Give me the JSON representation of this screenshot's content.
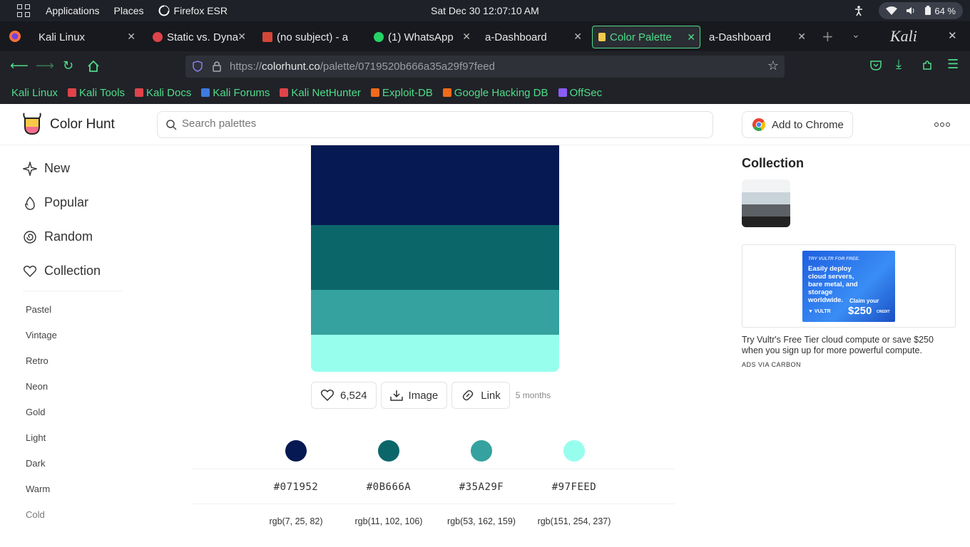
{
  "system": {
    "applications": "Applications",
    "places": "Places",
    "app_name": "Firefox ESR",
    "clock": "Sat Dec 30  12:07:10 AM",
    "battery": "64 %"
  },
  "tabs": [
    {
      "label": "Kali Linux",
      "color": "#2f6fdc"
    },
    {
      "label": "Static vs. Dyna",
      "color": "#e0434a"
    },
    {
      "label": "(no subject) - a",
      "color": "#d44638"
    },
    {
      "label": "(1) WhatsApp",
      "color": "#25d366"
    },
    {
      "label": "a-Dashboard",
      "color": ""
    },
    {
      "label": "Color Palette",
      "color": "#f2c94c"
    },
    {
      "label": "a-Dashboard",
      "color": ""
    }
  ],
  "url": {
    "prefix": "https://",
    "domain": "colorhunt.co",
    "path": "/palette/0719520b666a35a29f97feed"
  },
  "bookmarks": [
    {
      "label": "Kali Linux",
      "color": "#4fdc8a"
    },
    {
      "label": "Kali Tools",
      "color": "#e0434a"
    },
    {
      "label": "Kali Docs",
      "color": "#e0434a"
    },
    {
      "label": "Kali Forums",
      "color": "#3d7be0"
    },
    {
      "label": "Kali NetHunter",
      "color": "#e0434a"
    },
    {
      "label": "Exploit-DB",
      "color": "#f26a1b"
    },
    {
      "label": "Google Hacking DB",
      "color": "#f26a1b"
    },
    {
      "label": "OffSec",
      "color": "#8b5cf6"
    }
  ],
  "site": {
    "brand": "Color Hunt",
    "search_placeholder": "Search palettes",
    "add_to_chrome": "Add to Chrome"
  },
  "sidebar": {
    "main": [
      {
        "label": "New",
        "icon": "sparkle-icon"
      },
      {
        "label": "Popular",
        "icon": "flame-icon"
      },
      {
        "label": "Random",
        "icon": "spiral-icon"
      },
      {
        "label": "Collection",
        "icon": "heart-icon"
      }
    ],
    "tags": [
      "Pastel",
      "Vintage",
      "Retro",
      "Neon",
      "Gold",
      "Light",
      "Dark",
      "Warm",
      "Cold"
    ]
  },
  "palette": {
    "colors": [
      "#071952",
      "#0B666A",
      "#35A29F",
      "#97FEED"
    ],
    "hex": [
      "#071952",
      "#0B666A",
      "#35A29F",
      "#97FEED"
    ],
    "rgb": [
      "rgb(7, 25, 82)",
      "rgb(11, 102, 106)",
      "rgb(53, 162, 159)",
      "rgb(151, 254, 237)"
    ],
    "likes": "6,524",
    "image_label": "Image",
    "link_label": "Link",
    "age": "5 months"
  },
  "collection": {
    "title": "Collection",
    "thumb_colors": [
      "#f1f3f5",
      "#c9d3da",
      "#5c6166",
      "#222222"
    ]
  },
  "ad": {
    "img_try": "TRY VULTR FOR FREE.",
    "img_headline": "Easily deploy cloud servers, bare metal, and storage worldwide.",
    "img_brand": "VULTR",
    "img_claim": "Claim your",
    "img_amount": "$250",
    "img_credit": "CREDIT",
    "text": "Try Vultr's Free Tier cloud compute or save $250 when you sign up for more powerful compute.",
    "via": "ADS VIA CARBON"
  }
}
